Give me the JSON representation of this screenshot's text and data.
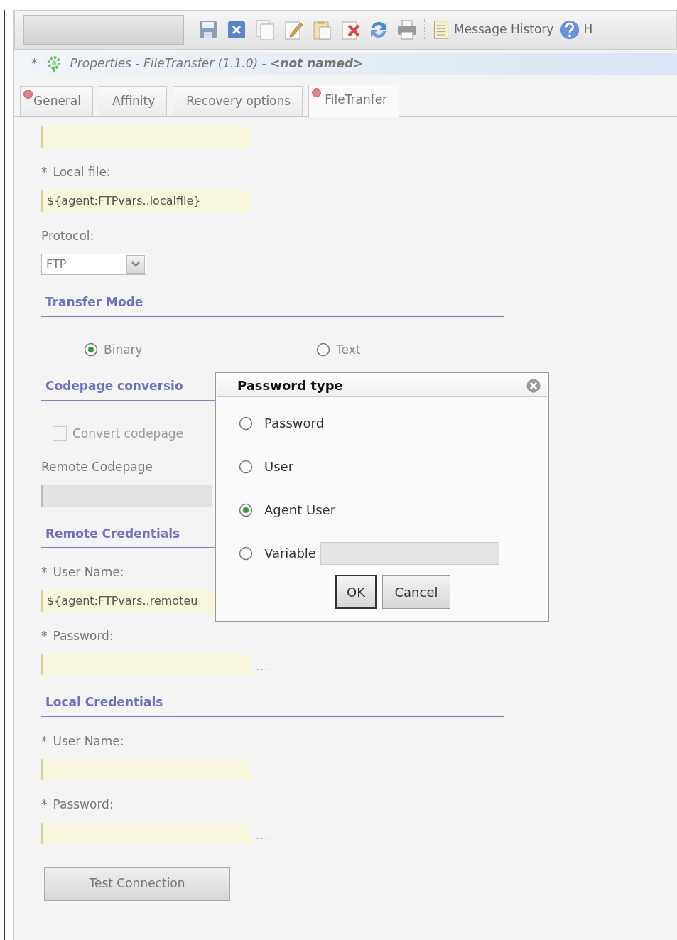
{
  "toolbar": {
    "action_button": {
      "disabled": true
    },
    "message_history": "Message History",
    "help": "H"
  },
  "title_bar": {
    "modified_mark": "*",
    "text": "Properties - FileTransfer (1.1.0) - **<not named>**"
  },
  "tabs": [
    {
      "label": "General",
      "selected": false,
      "error": true
    },
    {
      "label": "Affinity",
      "selected": false,
      "error": false
    },
    {
      "label": "Recovery options",
      "selected": false,
      "error": false
    },
    {
      "label": "FileTranfer",
      "selected": true,
      "error": true
    }
  ],
  "form": [
    {
      "kind": "field"
    },
    {
      "kind": "label",
      "text": "Local file:",
      "required_mark": "*"
    },
    {
      "kind": "field",
      "value": "${agent:FTPvars..localfile}"
    },
    {
      "kind": "label",
      "text": "Protocol:"
    },
    {
      "kind": "select",
      "value": "FTP"
    },
    {
      "kind": "heading",
      "text": "Transfer Mode"
    },
    {
      "kind": "radios",
      "options": [
        {
          "label": "Binary",
          "selected": true
        },
        {
          "label": "Text",
          "selected": false
        }
      ]
    },
    {
      "kind": "heading",
      "text": "Codepage conversio"
    },
    {
      "kind": "checkbox",
      "label": "Convert codepage",
      "checked": false
    },
    {
      "kind": "label",
      "text": "Remote Codepage"
    },
    {
      "kind": "field",
      "disabled": true
    },
    {
      "kind": "heading",
      "text": "Remote Credentials"
    },
    {
      "kind": "label",
      "text": "User Name:",
      "required_mark": "*"
    },
    {
      "kind": "field",
      "value": "${agent:FTPvars..remoteu"
    },
    {
      "kind": "label",
      "text": "Password:",
      "required_mark": "*"
    },
    {
      "kind": "field",
      "browse": "..."
    },
    {
      "kind": "heading",
      "text": "Local Credentials"
    },
    {
      "kind": "label",
      "text": "User Name:",
      "required_mark": "*"
    },
    {
      "kind": "field"
    },
    {
      "kind": "label",
      "text": "Password:",
      "required_mark": "*"
    },
    {
      "kind": "field",
      "browse": "..."
    },
    {
      "kind": "button",
      "label": "Test Connection"
    }
  ],
  "dialog": {
    "title": "Password type",
    "options": [
      {
        "label": "Password",
        "selected": false
      },
      {
        "label": "User",
        "selected": false
      },
      {
        "label": "Agent User",
        "selected": true
      },
      {
        "label": "Variable",
        "selected": false,
        "field": true
      }
    ],
    "buttons": [
      {
        "label": "OK",
        "default": true
      },
      {
        "label": "Cancel",
        "default": false
      }
    ]
  }
}
